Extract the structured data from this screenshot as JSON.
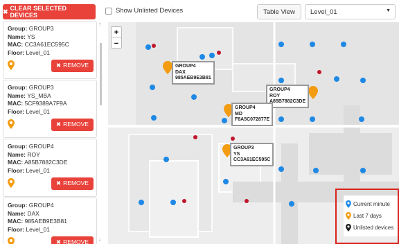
{
  "toolbar": {
    "clear_label": "CLEAR SELECTED DEVICES",
    "show_unlisted_label": "Show Unlisted Devices",
    "table_view_label": "Table View",
    "level_value": "Level_01"
  },
  "colors": {
    "danger": "#e8423a",
    "current_minute": "#1e88e5",
    "last_7_days": "#f39c12",
    "unlisted": "#222222",
    "legend_border": "#d9221c"
  },
  "devices": [
    {
      "group": "GROUP3",
      "name": "YS",
      "mac": "CC3A61EC595C",
      "floor": "Level_01"
    },
    {
      "group": "GROUP3",
      "name": "YS_MBA",
      "mac": "5CF9389A7F9A",
      "floor": "Level_01"
    },
    {
      "group": "GROUP4",
      "name": "ROY",
      "mac": "A85B7882C3DE",
      "floor": "Level_01"
    },
    {
      "group": "GROUP4",
      "name": "DAX",
      "mac": "985AEB9E3B81",
      "floor": "Level_01"
    }
  ],
  "card_labels": {
    "group": "Group:",
    "name": "Name:",
    "mac": "MAC:",
    "floor": "Floor:",
    "remove": "REMOVE"
  },
  "callouts": [
    {
      "group": "GROUP4",
      "name": "DAX",
      "mac": "985AEB9E3B81"
    },
    {
      "group": "GROUP4",
      "name": "ROY",
      "mac": "A85B7882C3DE"
    },
    {
      "group": "GROUP4",
      "name": "MD",
      "mac": "F8A5C072877E"
    },
    {
      "group": "GROUP3",
      "name": "YS",
      "mac": "CC3A61EC595C"
    }
  ],
  "legend": {
    "current_minute": "Current minute",
    "last_7_days": "Last 7 days",
    "unlisted": "Unlisted devices"
  },
  "zoom": {
    "in": "+",
    "out": "−"
  }
}
